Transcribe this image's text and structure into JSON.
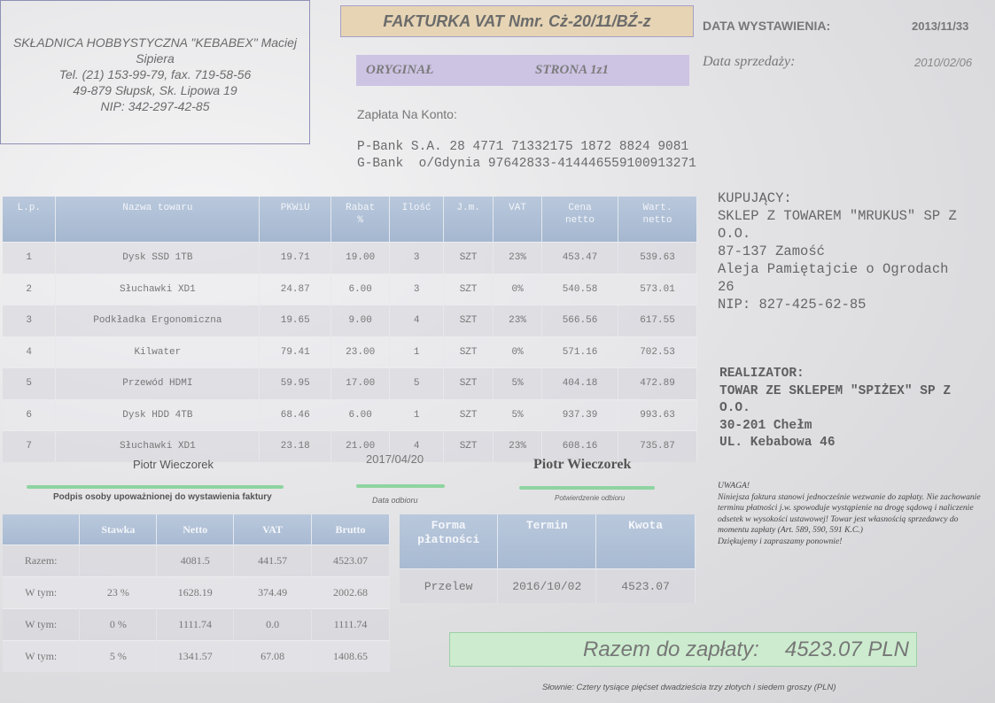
{
  "seller": {
    "name_line1": "SKŁADNICA HOBBYSTYCZNA \"KEBABEX\" Maciej",
    "name_line2": "Sipiera",
    "phone": "Tel. (21) 153-99-79, fax. 719-58-56",
    "address": "49-879 Słupsk, Sk. Lipowa 19",
    "nip": "NIP: 342-297-42-85"
  },
  "header": {
    "title": "FAKTURKA VAT Nmr. Cż-20/11/BŹ-z",
    "original": "ORYGINAŁ",
    "page": "STRONA 1z1"
  },
  "dates": {
    "issue_label": "DATA WYSTAWIENIA:",
    "issue_value": "2013/11/33",
    "sale_label": "Data sprzedaży:",
    "sale_value": "2010/02/06"
  },
  "payment_account": {
    "label": "Zapłata Na Konto:",
    "bank1": "P-Bank S.A. 28 4771 71332175 1872 8824 9081",
    "bank2": "G-Bank  o/Gdynia 97642833-414446559100913271"
  },
  "buyer": {
    "label": "KUPUJĄCY:",
    "name_line1": "SKLEP Z TOWAREM \"MRUKUS\" SP Z",
    "name_line2": "O.O.",
    "city": "87-137 Zamość",
    "street_line1": "Aleja Pamiętajcie o Ogrodach",
    "street_line2": "26",
    "nip": "NIP: 827-425-62-85"
  },
  "realizer": {
    "label": "REALIZATOR:",
    "name_line1": "TOWAR ZE SKLEPEM \"SPIŻEX\" SP Z",
    "name_line2": "O.O.",
    "city": "30-201 Chełm",
    "street": "UL. Kebabowa 46"
  },
  "items_table": {
    "headers": [
      "L.p.",
      "Nazwa towaru",
      "PKWiU",
      "Rabat\n%",
      "Ilość",
      "J.m.",
      "VAT",
      "Cena\nnetto",
      "Wart.\nnetto"
    ],
    "rows": [
      [
        "1",
        "Dysk SSD 1TB",
        "19.71",
        "19.00",
        "3",
        "SZT",
        "23%",
        "453.47",
        "539.63"
      ],
      [
        "2",
        "Słuchawki XD1",
        "24.87",
        "6.00",
        "3",
        "SZT",
        "0%",
        "540.58",
        "573.01"
      ],
      [
        "3",
        "Podkładka Ergonomiczna",
        "19.65",
        "9.00",
        "4",
        "SZT",
        "23%",
        "566.56",
        "617.55"
      ],
      [
        "4",
        "Kilwater",
        "79.41",
        "23.00",
        "1",
        "SZT",
        "0%",
        "571.16",
        "702.53"
      ],
      [
        "5",
        "Przewód HDMI",
        "59.95",
        "17.00",
        "5",
        "SZT",
        "5%",
        "404.18",
        "472.89"
      ],
      [
        "6",
        "Dysk HDD 4TB",
        "68.46",
        "6.00",
        "1",
        "SZT",
        "5%",
        "937.39",
        "993.63"
      ],
      [
        "7",
        "Słuchawki XD1",
        "23.18",
        "21.00",
        "4",
        "SZT",
        "23%",
        "608.16",
        "735.87"
      ]
    ]
  },
  "signatures": {
    "issuer_name": "Piotr Wieczorek",
    "issuer_caption": "Podpis osoby upoważnionej do wystawienia faktury",
    "receipt_date": "2017/04/20",
    "receipt_date_caption": "Data odbioru",
    "receiver_name": "Piotr Wieczorek",
    "receiver_caption": "Potwierdzenie  odbioru"
  },
  "summary_table": {
    "headers": [
      "",
      "Stawka",
      "Netto",
      "VAT",
      "Brutto"
    ],
    "rows": [
      [
        "Razem:",
        "",
        "4081.5",
        "441.57",
        "4523.07"
      ],
      [
        "W tym:",
        "23 %",
        "1628.19",
        "374.49",
        "2002.68"
      ],
      [
        "W tym:",
        "0 %",
        "1111.74",
        "0.0",
        "1111.74"
      ],
      [
        "W tym:",
        "5 %",
        "1341.57",
        "67.08",
        "1408.65"
      ]
    ]
  },
  "payment_table": {
    "headers": [
      "Forma\npłatności",
      "Termin",
      "Kwota"
    ],
    "rows": [
      [
        "Przelew",
        "2016/10/02",
        "4523.07"
      ]
    ]
  },
  "notice": {
    "title": "UWAGA!",
    "body": "Niniejsza faktura stanowi jednocześnie wezwanie do zapłaty. Nie zachowanie terminu płatności j.w. spowoduje wystąpienie na drogę sądową i naliczenie odsetek w wysokości ustawowej! Towar jest własnością sprzedawcy do momentu zapłaty (Art. 589, 590, 591 K.C.)",
    "thanks": "Dziękujemy i zapraszamy ponownie!"
  },
  "total": {
    "label": "Razem do zapłaty:",
    "value": "4523.07 PLN"
  },
  "in_words": "Słownie: Cztery tysiące pięćset dwadzieścia trzy złotych i siedem groszy (PLN)"
}
